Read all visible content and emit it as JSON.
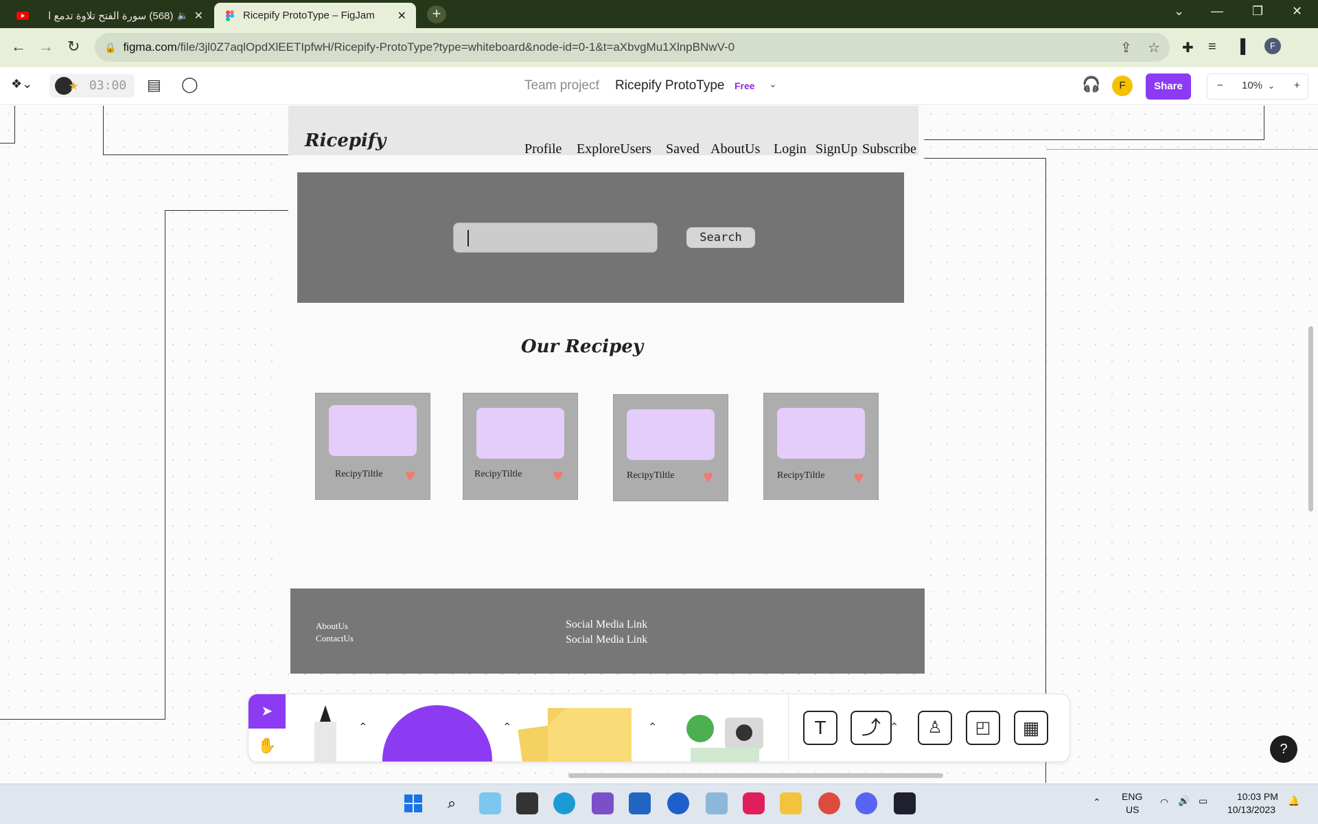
{
  "browser": {
    "tabs": [
      {
        "title": "(568) سورة الفتح تلاوة تدمع ا",
        "active": false
      },
      {
        "title": "Ricepify ProtoType – FigJam",
        "active": true
      }
    ],
    "url_host": "figma.com",
    "url_path": "/file/3jl0Z7aqlOpdXlEETIpfwH/Ricepify-ProtoType?type=whiteboard&node-id=0-1&t=aXbvgMu1XlnpBNwV-0",
    "profile_initial": "F"
  },
  "figjam": {
    "timer": "03:00",
    "breadcrumb_team": "Team project",
    "breadcrumb_sep": "/",
    "file_name": "Ricepify ProtoType",
    "plan_badge": "Free",
    "user_initial": "F",
    "share_label": "Share",
    "zoom": "10%",
    "zoom_out": "−",
    "zoom_in": "+"
  },
  "prototype": {
    "logo": "Ricepify",
    "nav": [
      "Profile",
      "ExploreUsers",
      "Saved",
      "AboutUs",
      "Login",
      "SignUp",
      "Subscribe"
    ],
    "search_button": "Search",
    "section_title": "Our Recipey",
    "cards": [
      {
        "title": "RecipyTiltle"
      },
      {
        "title": "RecipyTiltle"
      },
      {
        "title": "RecipyTiltle"
      },
      {
        "title": "RecipyTiltle"
      }
    ],
    "footer": {
      "about": "AboutUs",
      "contact": "ContactUs",
      "social_1": "Social Media Link",
      "social_2": "Social Media Link"
    }
  },
  "help_label": "?",
  "taskbar": {
    "lang_1": "ENG",
    "lang_2": "US",
    "time": "10:03 PM",
    "date": "10/13/2023"
  },
  "colors": {
    "accent_purple": "#8c3bf2",
    "card_image": "#e4cdfa",
    "heart": "#f07a6d",
    "hero_grey": "#747474"
  }
}
